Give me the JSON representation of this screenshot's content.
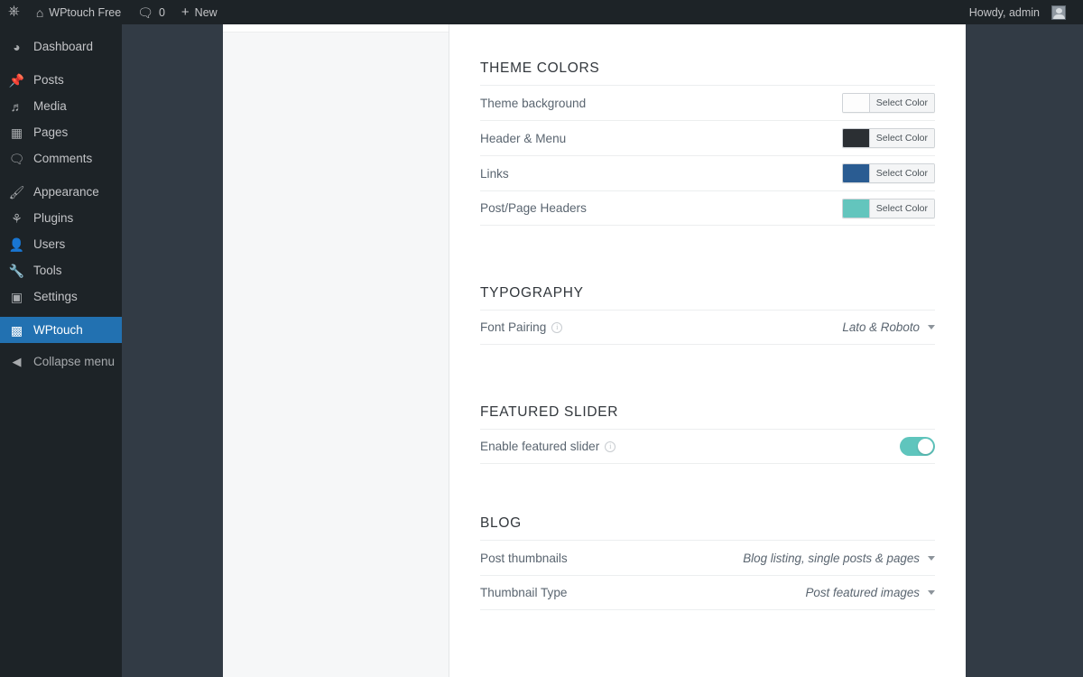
{
  "adminbar": {
    "wp_logo": "wordpress-logo-icon",
    "site_name": "WPtouch Free",
    "home_icon": "home-icon",
    "comments_icon": "comment-bubble-icon",
    "comments_count": "0",
    "new_icon": "plus-icon",
    "new_label": "New",
    "howdy": "Howdy, admin",
    "avatar_icon": "user-avatar-icon"
  },
  "sidebar": {
    "items": [
      {
        "label": "Dashboard",
        "icon": "dashboard-icon",
        "glyph": "◷",
        "active": false
      },
      {
        "label": "Posts",
        "icon": "pin-icon",
        "glyph": "✎",
        "active": false
      },
      {
        "label": "Media",
        "icon": "media-icon",
        "glyph": "♬",
        "active": false
      },
      {
        "label": "Pages",
        "icon": "page-icon",
        "glyph": "▤",
        "active": false
      },
      {
        "label": "Comments",
        "icon": "comment-bubble-icon",
        "glyph": "❏",
        "active": false
      },
      {
        "label": "Appearance",
        "icon": "paintbrush-icon",
        "glyph": "✒",
        "active": false
      },
      {
        "label": "Plugins",
        "icon": "plug-icon",
        "glyph": "⚲",
        "active": false
      },
      {
        "label": "Users",
        "icon": "user-icon",
        "glyph": "☺",
        "active": false
      },
      {
        "label": "Tools",
        "icon": "wrench-icon",
        "glyph": "⚒",
        "active": false
      },
      {
        "label": "Settings",
        "icon": "settings-sliders-icon",
        "glyph": "▣",
        "active": false
      },
      {
        "label": "WPtouch",
        "icon": "wptouch-icon",
        "glyph": "▥",
        "active": true
      }
    ],
    "collapse": {
      "label": "Collapse menu",
      "icon": "collapse-left-icon",
      "glyph": "◀"
    }
  },
  "main": {
    "sections": [
      {
        "title": "THEME COLORS",
        "rows": [
          {
            "label": "Theme background",
            "control": "color",
            "swatch": "#fdfdfd",
            "button": "Select Color"
          },
          {
            "label": "Header & Menu",
            "control": "color",
            "swatch": "#2b2f33",
            "button": "Select Color"
          },
          {
            "label": "Links",
            "control": "color",
            "swatch": "#2a5c92",
            "button": "Select Color"
          },
          {
            "label": "Post/Page Headers",
            "control": "color",
            "swatch": "#63c5bd",
            "button": "Select Color"
          }
        ]
      },
      {
        "title": "TYPOGRAPHY",
        "rows": [
          {
            "label": "Font Pairing",
            "info": true,
            "control": "select",
            "value": "Lato & Roboto"
          }
        ]
      },
      {
        "title": "FEATURED SLIDER",
        "rows": [
          {
            "label": "Enable featured slider",
            "info": true,
            "control": "toggle",
            "value": "on"
          }
        ]
      },
      {
        "title": "BLOG",
        "rows": [
          {
            "label": "Post thumbnails",
            "control": "select",
            "value": "Blog listing, single posts & pages"
          },
          {
            "label": "Thumbnail Type",
            "control": "select",
            "value": "Post featured images"
          }
        ]
      }
    ]
  },
  "colors": {
    "adminbar_bg": "#1d2327",
    "sidebar_bg": "#1d2327",
    "active_menu": "#2271b1",
    "workarea_bg": "#323b45",
    "panel_bg": "#f6f7f8",
    "accent_teal": "#5fc5bd"
  }
}
